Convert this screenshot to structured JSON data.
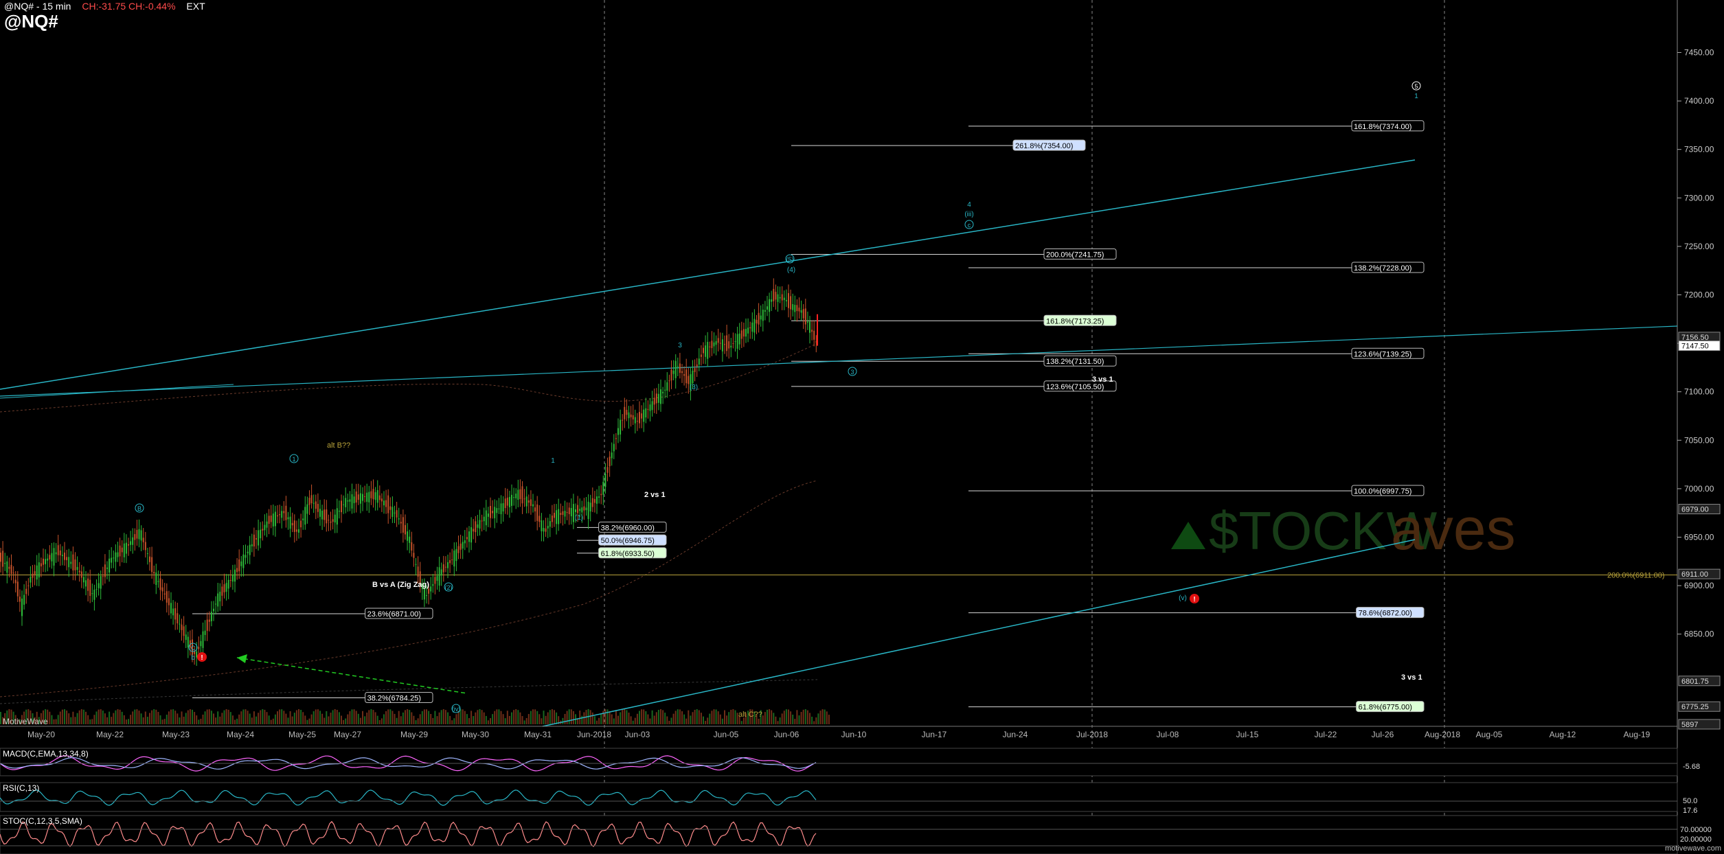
{
  "header": {
    "symbol_interval": "@NQ# - 15 min",
    "change": "CH:-31.75  CH:-0.44%",
    "session": "EXT"
  },
  "title": "@NQ#",
  "brand": "MotiveWave",
  "site": "motivewave.com",
  "watermark": "$TOCKWaves",
  "colors": {
    "bg": "#000000",
    "cyan": "#29b6c6",
    "candle_up": "#2ebd3a",
    "candle_down": "#c8542b",
    "gold": "#b8a23a",
    "fib_line": "#d8d8d8",
    "macd": "#ff66ff",
    "signal": "#9fb6ff",
    "rsi": "#29b6c6",
    "stoch": "#ff8c8c",
    "alert": "#e11111"
  },
  "chart_data": {
    "type": "candlestick",
    "timeframe": "15 min",
    "y_axis": {
      "ticks": [
        6850,
        6900,
        6950,
        7000,
        7050,
        7100,
        7150,
        7200,
        7250,
        7300,
        7350,
        7400,
        7450
      ],
      "tick_labels": [
        "6850.00",
        "6900.00",
        "6950.00",
        "7000.00",
        "7050.00",
        "7100.00",
        "7150.00",
        "7200.00",
        "7250.00",
        "7300.00",
        "7350.00",
        "7400.00",
        "7450.00"
      ],
      "ylim": [
        6815,
        7470
      ]
    },
    "x_axis": {
      "labels": [
        "May-20",
        "May-22",
        "May-23",
        "May-24",
        "May-25",
        "May-27",
        "May-29",
        "May-30",
        "May-31",
        "Jun-2018",
        "Jun-03",
        "Jun-05",
        "Jun-06",
        "Jun-10",
        "Jun-17",
        "Jun-24",
        "Jul-2018",
        "Jul-08",
        "Jul-15",
        "Jul-22",
        "Jul-26",
        "Aug-2018",
        "Aug-05",
        "Aug-12",
        "Aug-19"
      ]
    },
    "price_path": [
      [
        0,
        6930
      ],
      [
        6,
        6915
      ],
      [
        10,
        6878
      ],
      [
        14,
        6905
      ],
      [
        20,
        6922
      ],
      [
        28,
        6935
      ],
      [
        36,
        6920
      ],
      [
        44,
        6890
      ],
      [
        52,
        6925
      ],
      [
        60,
        6940
      ],
      [
        66,
        6955
      ],
      [
        72,
        6915
      ],
      [
        80,
        6880
      ],
      [
        88,
        6845
      ],
      [
        92,
        6828
      ],
      [
        96,
        6850
      ],
      [
        102,
        6885
      ],
      [
        110,
        6910
      ],
      [
        118,
        6940
      ],
      [
        126,
        6965
      ],
      [
        134,
        6975
      ],
      [
        140,
        6955
      ],
      [
        146,
        6990
      ],
      [
        150,
        6978
      ],
      [
        156,
        6965
      ],
      [
        162,
        6985
      ],
      [
        170,
        6990
      ],
      [
        178,
        6992
      ],
      [
        186,
        6975
      ],
      [
        192,
        6950
      ],
      [
        196,
        6915
      ],
      [
        200,
        6888
      ],
      [
        206,
        6910
      ],
      [
        212,
        6925
      ],
      [
        220,
        6950
      ],
      [
        228,
        6970
      ],
      [
        236,
        6980
      ],
      [
        244,
        6995
      ],
      [
        250,
        6985
      ],
      [
        256,
        6955
      ],
      [
        260,
        6970
      ],
      [
        268,
        6975
      ],
      [
        276,
        6978
      ],
      [
        282,
        6992
      ],
      [
        286,
        7025
      ],
      [
        290,
        7058
      ],
      [
        294,
        7080
      ],
      [
        300,
        7070
      ],
      [
        306,
        7085
      ],
      [
        312,
        7100
      ],
      [
        318,
        7128
      ],
      [
        324,
        7110
      ],
      [
        330,
        7140
      ],
      [
        338,
        7152
      ],
      [
        344,
        7148
      ],
      [
        350,
        7160
      ],
      [
        356,
        7172
      ],
      [
        360,
        7185
      ],
      [
        364,
        7200
      ],
      [
        368,
        7198
      ],
      [
        372,
        7190
      ],
      [
        376,
        7185
      ],
      [
        380,
        7170
      ],
      [
        384,
        7148
      ]
    ],
    "last_price": "7147.50",
    "price_labels": [
      {
        "text": "7156.50",
        "value": 7156.5
      },
      {
        "text": "7147.50",
        "value": 7147.5
      },
      {
        "text": "6979.00",
        "value": 6979
      },
      {
        "text": "6911.00",
        "value": 6912
      },
      {
        "text": "6801.75",
        "value": 6801.75
      },
      {
        "text": "6775.25",
        "value": 6775.25
      },
      {
        "text": "5897",
        "value": 6757
      }
    ],
    "fib_levels": [
      {
        "label": "161.8%(7374.00)",
        "value": 7374,
        "box": "default"
      },
      {
        "label": "261.8%(7354.00)",
        "value": 7354,
        "box": "blue"
      },
      {
        "label": "200.0%(7241.75)",
        "value": 7241.75,
        "box": "default"
      },
      {
        "label": "138.2%(7228.00)",
        "value": 7228,
        "box": "default"
      },
      {
        "label": "161.8%(7173.25)",
        "value": 7173.25,
        "box": "green"
      },
      {
        "label": "123.6%(7139.25)",
        "value": 7139.25,
        "box": "default"
      },
      {
        "label": "138.2%(7131.50)",
        "value": 7131.5,
        "box": "default"
      },
      {
        "label": "123.6%(7105.50)",
        "value": 7105.5,
        "box": "default"
      },
      {
        "label": "100.0%(6997.75)",
        "value": 6997.75,
        "box": "default"
      },
      {
        "label": "38.2%(6960.00)",
        "value": 6960,
        "box": "default"
      },
      {
        "label": "50.0%(6946.75)",
        "value": 6946.75,
        "box": "blue"
      },
      {
        "label": "61.8%(6933.50)",
        "value": 6933.5,
        "box": "green"
      },
      {
        "label": "23.6%(6871.00)",
        "value": 6871,
        "box": "default"
      },
      {
        "label": "78.6%(6872.00)",
        "value": 6872,
        "box": "blue"
      },
      {
        "label": "38.2%(6784.25)",
        "value": 6784.25,
        "box": "default"
      },
      {
        "label": "61.8%(6775.00)",
        "value": 6775,
        "box": "green"
      },
      {
        "label": "200.0%(6911.00)",
        "value": 6911,
        "box": "gold"
      }
    ],
    "annotations": [
      {
        "text": "3 vs 1"
      },
      {
        "text": "2 vs 1"
      },
      {
        "text": "B vs A (Zig Zag)"
      },
      {
        "text": "3 vs 1"
      },
      {
        "text": "alt B??"
      },
      {
        "text": "alt C??"
      }
    ],
    "wave_labels": [
      "1",
      "B",
      "C",
      "b",
      "1",
      "(1)",
      "(2)",
      "3",
      "(3)",
      "(4)",
      "(5)",
      "3",
      "4",
      "(iii)",
      "c",
      "5",
      "1",
      "(v)",
      "(iv)",
      "5"
    ],
    "indicators": [
      {
        "name": "MACD(C,EMA,13,34,8)",
        "value": "-5.68"
      },
      {
        "name": "RSI(C,13)",
        "levels": [
          "50.0"
        ],
        "value": "17.6"
      },
      {
        "name": "STOC(C,12,3,5,SMA)",
        "levels": [
          "70.00000",
          "20.00000"
        ]
      }
    ]
  }
}
